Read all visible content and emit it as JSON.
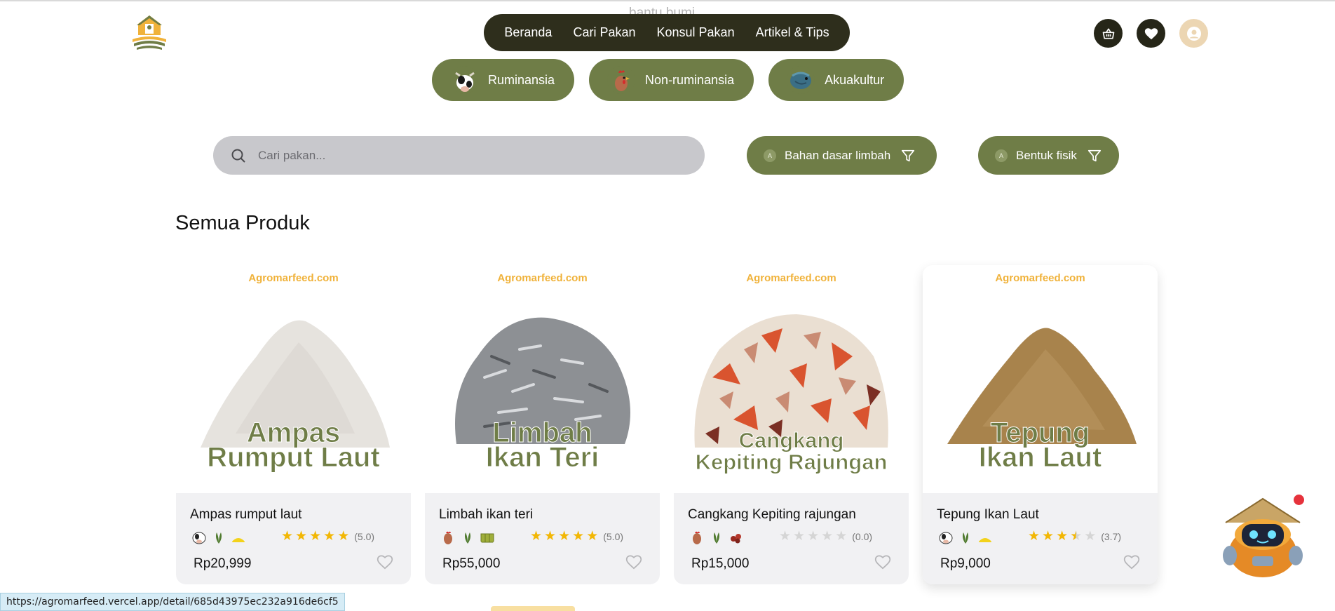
{
  "header": {
    "ghost_text": "bantu bumi",
    "nav": [
      "Beranda",
      "Cari Pakan",
      "Konsul Pakan",
      "Artikel & Tips"
    ],
    "icons": [
      "basket-icon",
      "heart-icon",
      "user-icon"
    ]
  },
  "categories": [
    {
      "label": "Ruminansia",
      "icon": "cow-icon"
    },
    {
      "label": "Non-ruminansia",
      "icon": "chicken-icon"
    },
    {
      "label": "Akuakultur",
      "icon": "fish-icon"
    }
  ],
  "search": {
    "placeholder": "Cari pakan..."
  },
  "filters": [
    {
      "badge": "A",
      "label": "Bahan dasar limbah"
    },
    {
      "badge": "A",
      "label": "Bentuk fisik"
    }
  ],
  "section": {
    "title": "Semua Produk"
  },
  "products": [
    {
      "watermark": "Agromarfeed.com",
      "label_line1": "Ampas",
      "label_line2": "Rumput Laut",
      "name": "Ampas rumput laut",
      "rating": 5.0,
      "rating_text": "(5.0)",
      "price": "Rp20,999",
      "image_color": "#e6e3de",
      "icons": [
        "cow-icon",
        "plant-icon",
        "powder-icon"
      ]
    },
    {
      "watermark": "Agromarfeed.com",
      "label_line1": "Limbah",
      "label_line2": "Ikan Teri",
      "name": "Limbah ikan teri",
      "rating": 5.0,
      "rating_text": "(5.0)",
      "price": "Rp55,000",
      "image_color": "#8d9094",
      "icons": [
        "chicken-icon",
        "plant-icon",
        "block-icon"
      ]
    },
    {
      "watermark": "Agromarfeed.com",
      "label_line1": "Cangkang",
      "label_line2": "Kepiting Rajungan",
      "name": "Cangkang Kepiting rajungan",
      "rating": 0.0,
      "rating_text": "(0.0)",
      "price": "Rp15,000",
      "image_color": "#d98a6a",
      "icons": [
        "chicken-icon",
        "plant-icon",
        "crumble-icon"
      ]
    },
    {
      "watermark": "Agromarfeed.com",
      "label_line1": "Tepung",
      "label_line2": "Ikan Laut",
      "name": "Tepung Ikan Laut",
      "rating": 3.7,
      "rating_text": "(3.7)",
      "price": "Rp9,000",
      "image_color": "#a8834c",
      "icons": [
        "cow-icon",
        "plant-icon",
        "powder-icon"
      ]
    }
  ],
  "chatbot": {
    "icon": "robot-assistant-icon",
    "notification": true
  },
  "status_bar": {
    "url": "https://agromarfeed.vercel.app/detail/685d43975ec232a916de6cf5"
  },
  "colors": {
    "olive": "#6f7d47",
    "dark": "#2e2e1c",
    "star": "#f2b705",
    "watermark": "#f0b23a"
  }
}
